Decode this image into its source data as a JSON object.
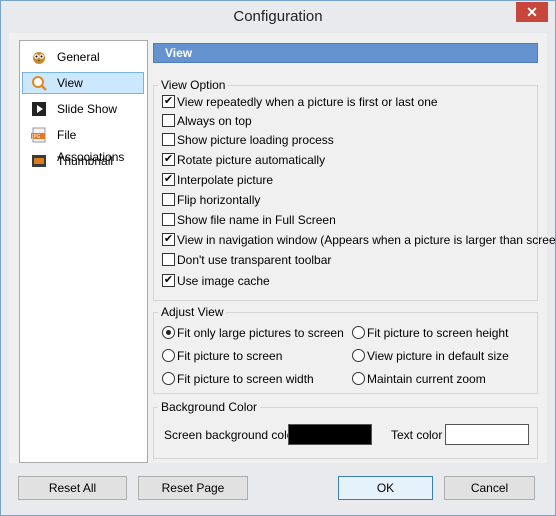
{
  "window": {
    "title": "Configuration",
    "close_glyph": "✕"
  },
  "sidebar": {
    "items": [
      {
        "label": "General",
        "icon": "owl-icon"
      },
      {
        "label": "View",
        "icon": "magnifier-icon"
      },
      {
        "label": "Slide Show",
        "icon": "play-icon"
      },
      {
        "label": "File Associations",
        "icon": "jpg-file-icon"
      },
      {
        "label": "Thumbnail",
        "icon": "filmstrip-icon"
      }
    ],
    "selected_index": 1
  },
  "header": {
    "title": "View"
  },
  "view_option": {
    "title": "View Option",
    "options": [
      {
        "label": "View repeatedly when a picture is first or last one",
        "checked": true
      },
      {
        "label": "Always on top",
        "checked": false
      },
      {
        "label": "Show picture loading process",
        "checked": false
      },
      {
        "label": "Rotate picture automatically",
        "checked": true
      },
      {
        "label": "Interpolate picture",
        "checked": true
      },
      {
        "label": "Flip horizontally",
        "checked": false
      },
      {
        "label": "Show file name in Full Screen",
        "checked": false
      },
      {
        "label": "View in navigation window (Appears when a picture is larger than screen)",
        "checked": true
      },
      {
        "label": "Don't use transparent toolbar",
        "checked": false
      },
      {
        "label": "Use image cache",
        "checked": true
      }
    ]
  },
  "adjust_view": {
    "title": "Adjust View",
    "options": [
      {
        "label": "Fit only large pictures to screen",
        "selected": true
      },
      {
        "label": "Fit picture to screen height",
        "selected": false
      },
      {
        "label": "Fit picture to screen",
        "selected": false
      },
      {
        "label": "View picture in default size",
        "selected": false
      },
      {
        "label": "Fit picture to screen width",
        "selected": false
      },
      {
        "label": "Maintain current zoom",
        "selected": false
      }
    ]
  },
  "background_color": {
    "title": "Background Color",
    "screen_label": "Screen background color",
    "screen_color": "#000000",
    "text_label": "Text color",
    "text_color": "#ffffff"
  },
  "buttons": {
    "reset_all": "Reset All",
    "reset_page": "Reset Page",
    "ok": "OK",
    "cancel": "Cancel"
  },
  "colors": {
    "header_bg": "#6593cf",
    "selection_bg": "#cce8ff",
    "close_bg": "#c7473c"
  }
}
